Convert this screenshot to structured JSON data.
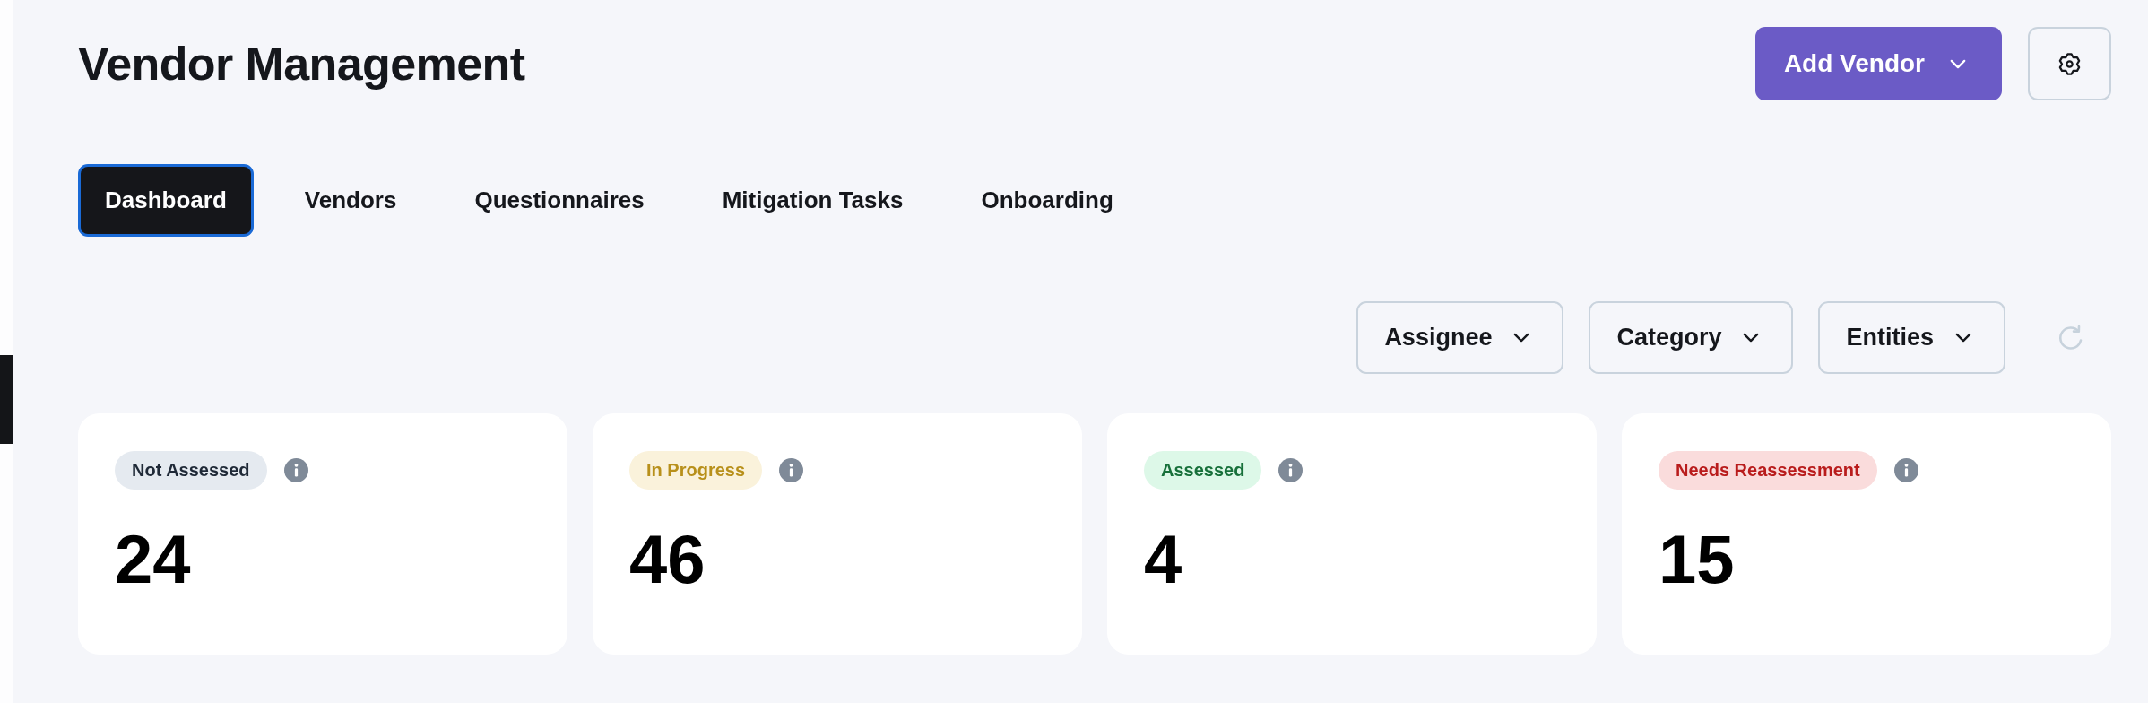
{
  "header": {
    "title": "Vendor Management",
    "add_button": "Add Vendor"
  },
  "tabs": [
    {
      "label": "Dashboard",
      "selected": true
    },
    {
      "label": "Vendors",
      "selected": false
    },
    {
      "label": "Questionnaires",
      "selected": false
    },
    {
      "label": "Mitigation Tasks",
      "selected": false
    },
    {
      "label": "Onboarding",
      "selected": false
    }
  ],
  "filters": [
    "Assignee",
    "Category",
    "Entities"
  ],
  "status_cards": [
    {
      "status": "Not Assessed",
      "color": "#1f2937",
      "count": "24"
    },
    {
      "status": "In Progress",
      "color": "#b8901a",
      "count": "46"
    },
    {
      "status": "Assessed",
      "color": "#17703a",
      "count": "4"
    },
    {
      "status": "Needs Reassessment",
      "color": "#b91c1c",
      "count": "15"
    }
  ]
}
